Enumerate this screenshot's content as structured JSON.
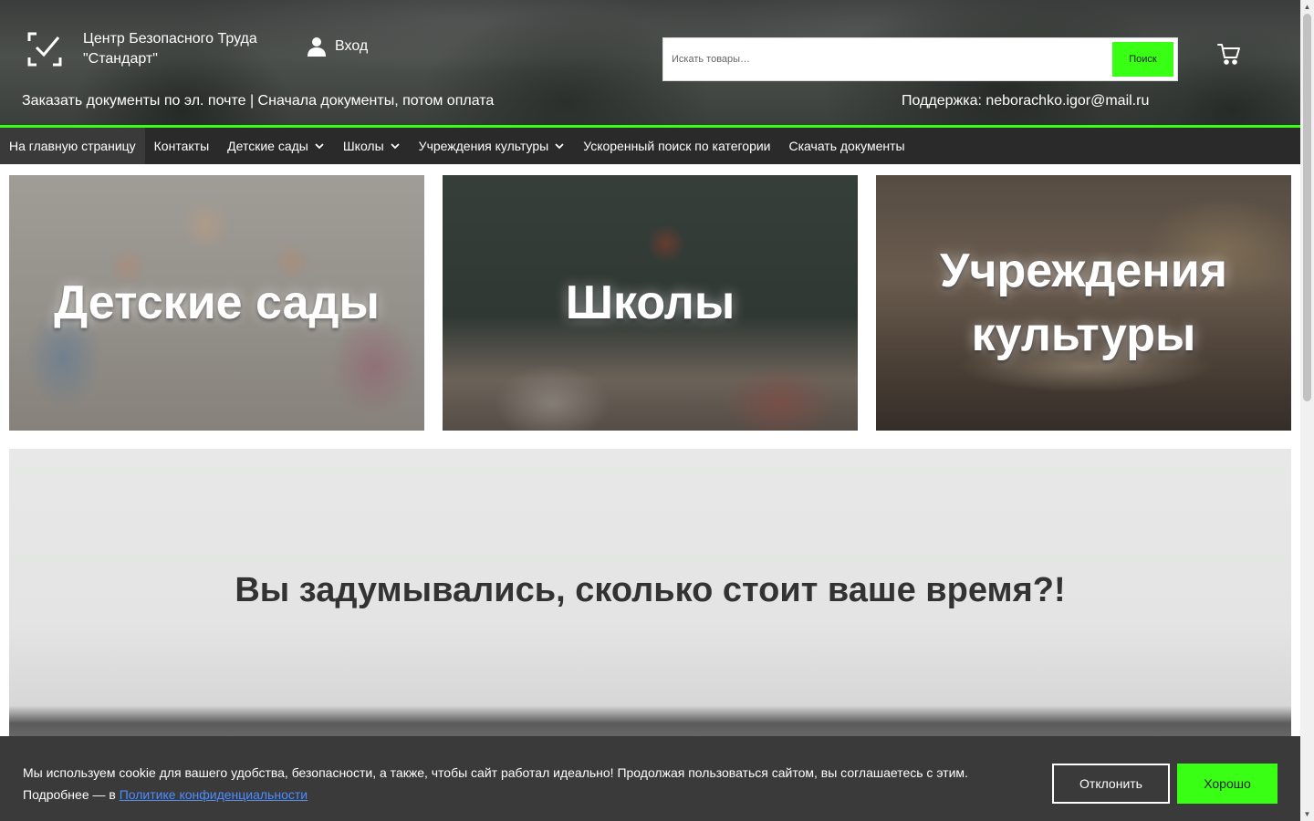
{
  "header": {
    "brand": "Центр Безопасного Труда \"Стандарт\"",
    "login_label": "Вход",
    "search": {
      "placeholder": "Искать товары…",
      "button_label": "Поиск"
    },
    "tagline": "Заказать документы по эл. почте | Сначала документы, потом оплата",
    "support": "Поддержка: neborachko.igor@mail.ru",
    "accent_color": "#39ff14"
  },
  "nav": {
    "items": [
      {
        "label": "На главную страницу",
        "active": true
      },
      {
        "label": "Контакты"
      },
      {
        "label": "Детские сады",
        "dropdown": true
      },
      {
        "label": "Школы",
        "dropdown": true
      },
      {
        "label": "Учреждения культуры",
        "dropdown": true
      },
      {
        "label": "Ускоренный поиск по категории"
      },
      {
        "label": "Скачать документы"
      }
    ]
  },
  "categories": [
    {
      "label": "Детские сады"
    },
    {
      "label": "Школы"
    },
    {
      "label": "Учреждения культуры"
    }
  ],
  "hero": {
    "title": "Вы задумывались, сколько стоит ваше время?!"
  },
  "cookie": {
    "text": "Мы используем cookie для вашего удобства, безопасности, а также, чтобы сайт работал идеально! Продолжая пользоваться сайтом, вы соглашаетесь с этим. Подробнее — в ",
    "link_label": "Политике конфиденциальности",
    "decline_label": "Отклонить",
    "accept_label": "Хорошо"
  }
}
